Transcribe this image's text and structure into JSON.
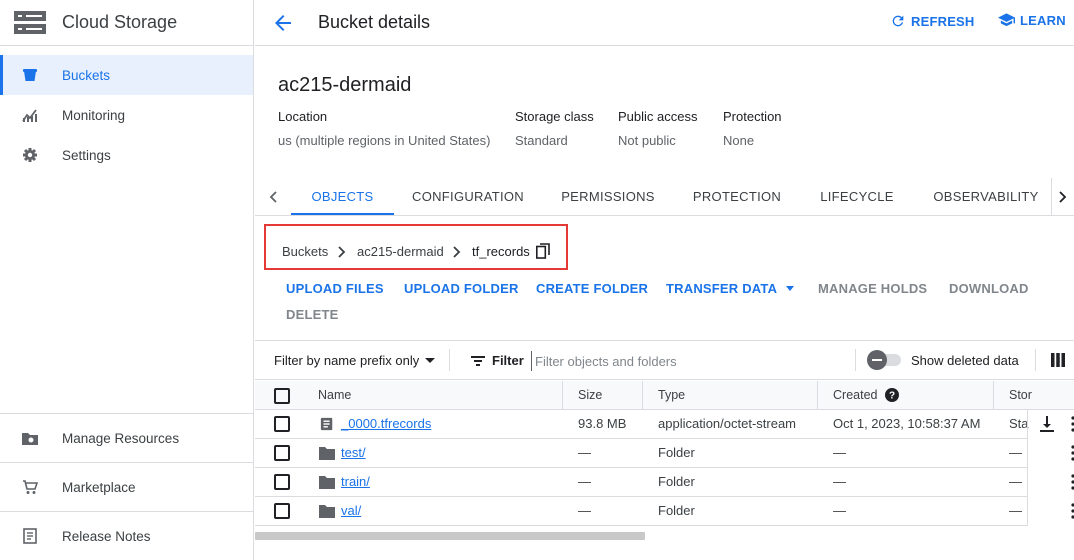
{
  "sidebar": {
    "title": "Cloud Storage",
    "items": [
      {
        "label": "Buckets",
        "icon": "bucket-icon"
      },
      {
        "label": "Monitoring",
        "icon": "chart-icon"
      },
      {
        "label": "Settings",
        "icon": "gear-icon"
      }
    ],
    "footer": [
      {
        "label": "Manage Resources",
        "icon": "folder-gear-icon"
      },
      {
        "label": "Marketplace",
        "icon": "cart-icon"
      },
      {
        "label": "Release Notes",
        "icon": "notes-icon"
      }
    ]
  },
  "header": {
    "title": "Bucket details",
    "refresh_label": "REFRESH",
    "learn_label": "LEARN"
  },
  "bucket": {
    "name": "ac215-dermaid",
    "info": [
      {
        "label": "Location",
        "value": "us (multiple regions in United States)"
      },
      {
        "label": "Storage class",
        "value": "Standard"
      },
      {
        "label": "Public access",
        "value": "Not public"
      },
      {
        "label": "Protection",
        "value": "None"
      }
    ]
  },
  "tabs": [
    "OBJECTS",
    "CONFIGURATION",
    "PERMISSIONS",
    "PROTECTION",
    "LIFECYCLE",
    "OBSERVABILITY"
  ],
  "active_tab": "OBJECTS",
  "breadcrumb": [
    "Buckets",
    "ac215-dermaid",
    "tf_records"
  ],
  "actions": {
    "upload_files": "UPLOAD FILES",
    "upload_folder": "UPLOAD FOLDER",
    "create_folder": "CREATE FOLDER",
    "transfer_data": "TRANSFER DATA",
    "manage_holds": "MANAGE HOLDS",
    "download": "DOWNLOAD",
    "delete": "DELETE"
  },
  "filter": {
    "mode": "Filter by name prefix only",
    "label": "Filter",
    "placeholder": "Filter objects and folders",
    "show_deleted": "Show deleted data"
  },
  "table": {
    "columns": [
      "Name",
      "Size",
      "Type",
      "Created",
      "Stor"
    ],
    "rows": [
      {
        "name": "_0000.tfrecords",
        "kind": "file",
        "size": "93.8 MB",
        "type": "application/octet-stream",
        "created": "Oct 1, 2023, 10:58:37 AM",
        "storage": "Sta"
      },
      {
        "name": "test/",
        "kind": "folder",
        "size": "—",
        "type": "Folder",
        "created": "—",
        "storage": "—"
      },
      {
        "name": "train/",
        "kind": "folder",
        "size": "—",
        "type": "Folder",
        "created": "—",
        "storage": "—"
      },
      {
        "name": "val/",
        "kind": "folder",
        "size": "—",
        "type": "Folder",
        "created": "—",
        "storage": "—"
      }
    ]
  },
  "colors": {
    "accent": "#1a73e8",
    "highlight_box": "#e53935",
    "active_bg": "#e8f0fe"
  }
}
